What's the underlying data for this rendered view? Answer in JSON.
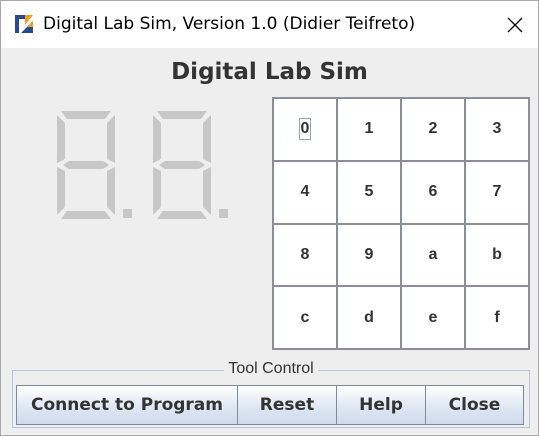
{
  "window": {
    "title": "Digital Lab Sim,  Version 1.0 (Didier Teifreto)"
  },
  "app": {
    "heading": "Digital Lab Sim"
  },
  "display": {
    "digits": [
      "8",
      "8"
    ],
    "state": "off"
  },
  "keypad": {
    "keys": [
      "0",
      "1",
      "2",
      "3",
      "4",
      "5",
      "6",
      "7",
      "8",
      "9",
      "a",
      "b",
      "c",
      "d",
      "e",
      "f"
    ],
    "focused_key": "0"
  },
  "tool_control": {
    "title": "Tool Control",
    "buttons": [
      "Connect to Program",
      "Reset",
      "Help",
      "Close"
    ]
  }
}
